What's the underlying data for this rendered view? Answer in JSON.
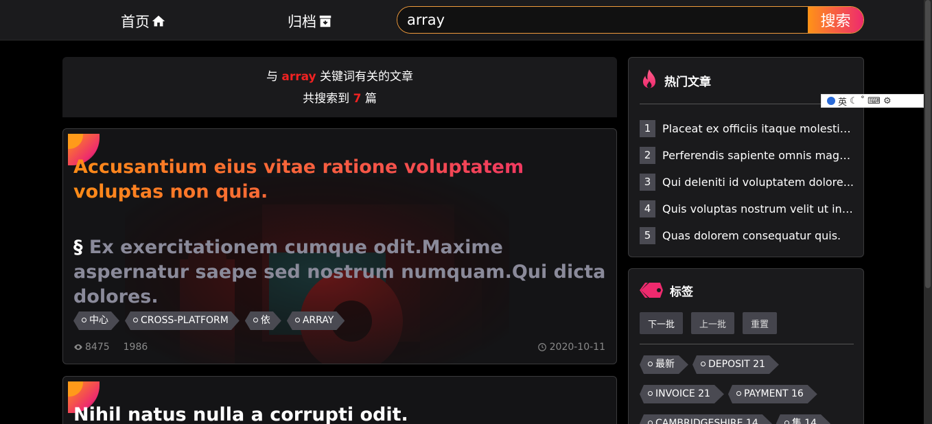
{
  "nav": {
    "home_label": "首页",
    "archive_label": "归档",
    "search_value": "array",
    "search_button": "搜索"
  },
  "result": {
    "line1_prefix": "与 ",
    "keyword": "array",
    "line1_suffix": " 关键词有关的文章",
    "line2_prefix": "共搜索到 ",
    "count": "7",
    "line2_suffix": " 篇"
  },
  "articles": [
    {
      "title": "Accusantium eius vitae ratione voluptatem voluptas non quia.",
      "excerpt_mark": "§",
      "excerpt": "Ex exercitationem cumque odit.Maxime aspernatur saepe sed nostrum numquam.Qui dicta dolores.",
      "tags": [
        "中心",
        "CROSS-PLATFORM",
        "依",
        "ARRAY"
      ],
      "views": "8475",
      "comments": "1986",
      "date": "2020-10-11"
    },
    {
      "title": "Nihil natus nulla a corrupti odit."
    }
  ],
  "hot": {
    "title": "热门文章",
    "items": [
      {
        "num": "1",
        "text": "Placeat ex officiis itaque molestiae..."
      },
      {
        "num": "2",
        "text": "Perferendis sapiente omnis magna..."
      },
      {
        "num": "3",
        "text": "Qui deleniti id voluptatem dolore..."
      },
      {
        "num": "4",
        "text": "Quis voluptas nostrum velit ut in d..."
      },
      {
        "num": "5",
        "text": "Quas dolorem consequatur quis."
      }
    ]
  },
  "tags": {
    "title": "标签",
    "next_label": "下一批",
    "prev_label": "上一批",
    "reset_label": "重置",
    "rows": [
      [
        "最新",
        "DEPOSIT 21"
      ],
      [
        "INVOICE 21",
        "PAYMENT 16"
      ],
      [
        "CAMBRIDGESHIRE 14",
        "集 14"
      ]
    ]
  },
  "ime": {
    "label": "英"
  },
  "colors": {
    "accent_orange": "#ff9317",
    "accent_pink": "#ee2a6e",
    "keyword_red": "#f02222"
  }
}
